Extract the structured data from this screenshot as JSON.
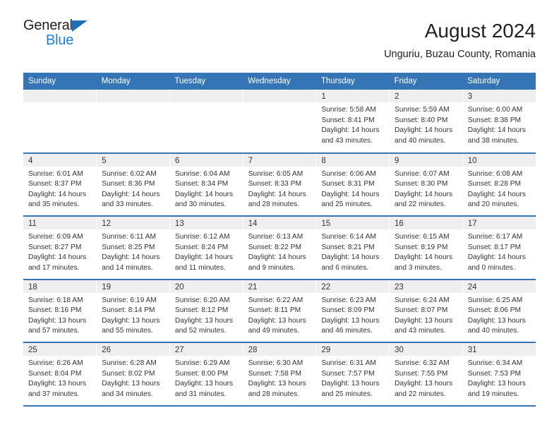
{
  "logo": {
    "word1": "General",
    "word2": "Blue",
    "triangle_icon": "triangle-icon",
    "color_dark": "#231f20",
    "color_blue": "#1d7fd4"
  },
  "header": {
    "title": "August 2024",
    "subtitle": "Unguriu, Buzau County, Romania"
  },
  "theme": {
    "header_blue": "#3575b5",
    "daynum_gray": "#efefef",
    "text": "#333333"
  },
  "weekdays": [
    "Sunday",
    "Monday",
    "Tuesday",
    "Wednesday",
    "Thursday",
    "Friday",
    "Saturday"
  ],
  "weeks": [
    [
      {
        "day": "",
        "sunrise": "",
        "sunset": "",
        "daylight": ""
      },
      {
        "day": "",
        "sunrise": "",
        "sunset": "",
        "daylight": ""
      },
      {
        "day": "",
        "sunrise": "",
        "sunset": "",
        "daylight": ""
      },
      {
        "day": "",
        "sunrise": "",
        "sunset": "",
        "daylight": ""
      },
      {
        "day": "1",
        "sunrise": "Sunrise: 5:58 AM",
        "sunset": "Sunset: 8:41 PM",
        "daylight": "Daylight: 14 hours and 43 minutes."
      },
      {
        "day": "2",
        "sunrise": "Sunrise: 5:59 AM",
        "sunset": "Sunset: 8:40 PM",
        "daylight": "Daylight: 14 hours and 40 minutes."
      },
      {
        "day": "3",
        "sunrise": "Sunrise: 6:00 AM",
        "sunset": "Sunset: 8:38 PM",
        "daylight": "Daylight: 14 hours and 38 minutes."
      }
    ],
    [
      {
        "day": "4",
        "sunrise": "Sunrise: 6:01 AM",
        "sunset": "Sunset: 8:37 PM",
        "daylight": "Daylight: 14 hours and 35 minutes."
      },
      {
        "day": "5",
        "sunrise": "Sunrise: 6:02 AM",
        "sunset": "Sunset: 8:36 PM",
        "daylight": "Daylight: 14 hours and 33 minutes."
      },
      {
        "day": "6",
        "sunrise": "Sunrise: 6:04 AM",
        "sunset": "Sunset: 8:34 PM",
        "daylight": "Daylight: 14 hours and 30 minutes."
      },
      {
        "day": "7",
        "sunrise": "Sunrise: 6:05 AM",
        "sunset": "Sunset: 8:33 PM",
        "daylight": "Daylight: 14 hours and 28 minutes."
      },
      {
        "day": "8",
        "sunrise": "Sunrise: 6:06 AM",
        "sunset": "Sunset: 8:31 PM",
        "daylight": "Daylight: 14 hours and 25 minutes."
      },
      {
        "day": "9",
        "sunrise": "Sunrise: 6:07 AM",
        "sunset": "Sunset: 8:30 PM",
        "daylight": "Daylight: 14 hours and 22 minutes."
      },
      {
        "day": "10",
        "sunrise": "Sunrise: 6:08 AM",
        "sunset": "Sunset: 8:28 PM",
        "daylight": "Daylight: 14 hours and 20 minutes."
      }
    ],
    [
      {
        "day": "11",
        "sunrise": "Sunrise: 6:09 AM",
        "sunset": "Sunset: 8:27 PM",
        "daylight": "Daylight: 14 hours and 17 minutes."
      },
      {
        "day": "12",
        "sunrise": "Sunrise: 6:11 AM",
        "sunset": "Sunset: 8:25 PM",
        "daylight": "Daylight: 14 hours and 14 minutes."
      },
      {
        "day": "13",
        "sunrise": "Sunrise: 6:12 AM",
        "sunset": "Sunset: 8:24 PM",
        "daylight": "Daylight: 14 hours and 11 minutes."
      },
      {
        "day": "14",
        "sunrise": "Sunrise: 6:13 AM",
        "sunset": "Sunset: 8:22 PM",
        "daylight": "Daylight: 14 hours and 9 minutes."
      },
      {
        "day": "15",
        "sunrise": "Sunrise: 6:14 AM",
        "sunset": "Sunset: 8:21 PM",
        "daylight": "Daylight: 14 hours and 6 minutes."
      },
      {
        "day": "16",
        "sunrise": "Sunrise: 6:15 AM",
        "sunset": "Sunset: 8:19 PM",
        "daylight": "Daylight: 14 hours and 3 minutes."
      },
      {
        "day": "17",
        "sunrise": "Sunrise: 6:17 AM",
        "sunset": "Sunset: 8:17 PM",
        "daylight": "Daylight: 14 hours and 0 minutes."
      }
    ],
    [
      {
        "day": "18",
        "sunrise": "Sunrise: 6:18 AM",
        "sunset": "Sunset: 8:16 PM",
        "daylight": "Daylight: 13 hours and 57 minutes."
      },
      {
        "day": "19",
        "sunrise": "Sunrise: 6:19 AM",
        "sunset": "Sunset: 8:14 PM",
        "daylight": "Daylight: 13 hours and 55 minutes."
      },
      {
        "day": "20",
        "sunrise": "Sunrise: 6:20 AM",
        "sunset": "Sunset: 8:12 PM",
        "daylight": "Daylight: 13 hours and 52 minutes."
      },
      {
        "day": "21",
        "sunrise": "Sunrise: 6:22 AM",
        "sunset": "Sunset: 8:11 PM",
        "daylight": "Daylight: 13 hours and 49 minutes."
      },
      {
        "day": "22",
        "sunrise": "Sunrise: 6:23 AM",
        "sunset": "Sunset: 8:09 PM",
        "daylight": "Daylight: 13 hours and 46 minutes."
      },
      {
        "day": "23",
        "sunrise": "Sunrise: 6:24 AM",
        "sunset": "Sunset: 8:07 PM",
        "daylight": "Daylight: 13 hours and 43 minutes."
      },
      {
        "day": "24",
        "sunrise": "Sunrise: 6:25 AM",
        "sunset": "Sunset: 8:06 PM",
        "daylight": "Daylight: 13 hours and 40 minutes."
      }
    ],
    [
      {
        "day": "25",
        "sunrise": "Sunrise: 6:26 AM",
        "sunset": "Sunset: 8:04 PM",
        "daylight": "Daylight: 13 hours and 37 minutes."
      },
      {
        "day": "26",
        "sunrise": "Sunrise: 6:28 AM",
        "sunset": "Sunset: 8:02 PM",
        "daylight": "Daylight: 13 hours and 34 minutes."
      },
      {
        "day": "27",
        "sunrise": "Sunrise: 6:29 AM",
        "sunset": "Sunset: 8:00 PM",
        "daylight": "Daylight: 13 hours and 31 minutes."
      },
      {
        "day": "28",
        "sunrise": "Sunrise: 6:30 AM",
        "sunset": "Sunset: 7:58 PM",
        "daylight": "Daylight: 13 hours and 28 minutes."
      },
      {
        "day": "29",
        "sunrise": "Sunrise: 6:31 AM",
        "sunset": "Sunset: 7:57 PM",
        "daylight": "Daylight: 13 hours and 25 minutes."
      },
      {
        "day": "30",
        "sunrise": "Sunrise: 6:32 AM",
        "sunset": "Sunset: 7:55 PM",
        "daylight": "Daylight: 13 hours and 22 minutes."
      },
      {
        "day": "31",
        "sunrise": "Sunrise: 6:34 AM",
        "sunset": "Sunset: 7:53 PM",
        "daylight": "Daylight: 13 hours and 19 minutes."
      }
    ]
  ]
}
